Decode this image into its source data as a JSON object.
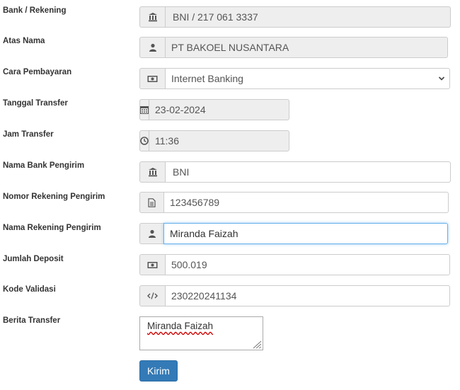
{
  "form": {
    "bank_rekening": {
      "label": "Bank / Rekening",
      "value": "BNI / 217 061 3337",
      "icon": "bank-icon"
    },
    "atas_nama": {
      "label": "Atas Nama",
      "value": "PT BAKOEL NUSANTARA",
      "icon": "user-icon"
    },
    "cara_pembayaran": {
      "label": "Cara Pembayaran",
      "value": "Internet Banking",
      "icon": "money-icon"
    },
    "tanggal_transfer": {
      "label": "Tanggal Transfer",
      "value": "23-02-2024",
      "icon": "calendar-icon"
    },
    "jam_transfer": {
      "label": "Jam Transfer",
      "value": "11:36",
      "icon": "clock-icon"
    },
    "nama_bank_pengirim": {
      "label": "Nama Bank Pengirim",
      "value": "BNI",
      "icon": "bank-icon"
    },
    "nomor_rekening_pengirim": {
      "label": "Nomor Rekening Pengirim",
      "value": "123456789",
      "icon": "document-icon"
    },
    "nama_rekening_pengirim": {
      "label": "Nama Rekening Pengirim",
      "value": "Miranda Faizah",
      "icon": "user-icon"
    },
    "jumlah_deposit": {
      "label": "Jumlah Deposit",
      "value": "500.019",
      "icon": "money-icon"
    },
    "kode_validasi": {
      "label": "Kode Validasi",
      "value": "230220241134",
      "icon": "code-icon"
    },
    "berita_transfer": {
      "label": "Berita Transfer",
      "value": "Miranda Faizah"
    },
    "submit_label": "Kirim"
  }
}
